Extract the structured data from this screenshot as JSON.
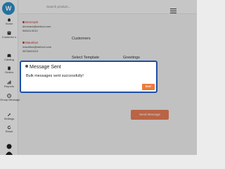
{
  "search": {
    "placeholder": "Search product..."
  },
  "sidebar": {
    "items": [
      {
        "label": "Home",
        "icon": "home-icon"
      },
      {
        "label": "Customer s",
        "icon": "customers-icon"
      },
      {
        "label": "Catalog",
        "icon": "catalog-icon"
      },
      {
        "label": "Orders",
        "icon": "orders-icon"
      },
      {
        "label": "Reports",
        "icon": "reports-icon"
      },
      {
        "label": "Group Message",
        "icon": "group-message-icon"
      },
      {
        "label": "Settings",
        "icon": "settings-icon"
      },
      {
        "label": "Reset",
        "icon": "reset-icon"
      }
    ]
  },
  "contacts": [
    {
      "name": "Denmark",
      "email": "denmark@webcci.com",
      "phone": "5461113210"
    },
    {
      "name": "Mauritius",
      "email": "mauritius@webcci.com",
      "phone": "9876543210"
    }
  ],
  "main": {
    "customers_label": "Customers",
    "select_template_label": "Select Template",
    "greetings_label": "Greetings",
    "send_button": "Send Message"
  },
  "dialog": {
    "title": "Message Sent",
    "message": "Bulk messages sent successfully!",
    "exit_label": "EXIT"
  },
  "colors": {
    "accent": "#2a8cc4",
    "dialog_border": "#1c4fa8",
    "exit_button": "#ef7a3c",
    "send_button": "#e27a55",
    "contact_name": "#c0392b"
  }
}
